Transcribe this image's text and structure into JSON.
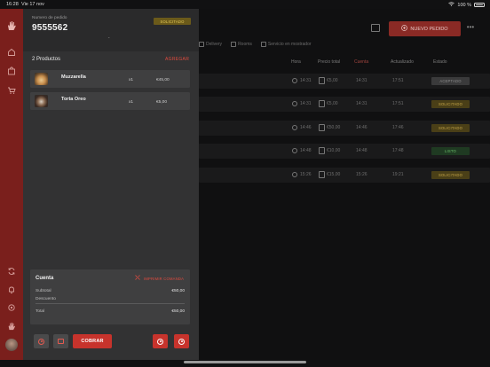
{
  "status_bar": {
    "time": "16:28",
    "date": "Vie 17 nov",
    "battery": "100 %"
  },
  "background": {
    "new_order_label": "NUEVO PEDIDO",
    "tabs": [
      "Delivery",
      "Rooms",
      "Servicio en mostrador"
    ],
    "columns": [
      "Hora",
      "Precio total",
      "Cuenta",
      "Actualizado",
      "Estado"
    ],
    "rows": [
      {
        "time": "14:31",
        "total": "€5,00",
        "cuenta": "14:31",
        "updated": "17:51",
        "status": "ACEPTADO",
        "status_color": "#8e8e8e",
        "status_bg": "#3a3a3b"
      },
      {
        "time": "14:31",
        "total": "€5,00",
        "cuenta": "14:31",
        "updated": "17:51",
        "status": "SOLICITADO",
        "status_color": "#c9a94a",
        "status_bg": "#4a3f17"
      },
      {
        "time": "14:46",
        "total": "€50,00",
        "cuenta": "14:46",
        "updated": "17:46",
        "status": "SOLICITADO",
        "status_color": "#c9a94a",
        "status_bg": "#4a3f17"
      },
      {
        "time": "14:48",
        "total": "€10,00",
        "cuenta": "14:48",
        "updated": "17:48",
        "status": "LISTO",
        "status_color": "#6bbf6b",
        "status_bg": "#1f3a22"
      },
      {
        "time": "15:26",
        "total": "€15,00",
        "cuenta": "15:26",
        "updated": "19:21",
        "status": "SOLICITADO",
        "status_color": "#c9a94a",
        "status_bg": "#4a3f17"
      }
    ]
  },
  "order": {
    "number_label": "Numero de pedido",
    "number": "9555562",
    "status": "SOLICITADO",
    "products_title": "2 Productos",
    "add_label": "AGREGAR",
    "products": [
      {
        "name": "Muzzarella",
        "qty": "x1",
        "price": "€45,00"
      },
      {
        "name": "Torta Oreo",
        "qty": "x1",
        "price": "€5,00"
      }
    ],
    "account": {
      "title": "Cuenta",
      "print_label": "IMPRIMIR COMANDA",
      "subtotal_label": "Subtotal",
      "subtotal": "€50,00",
      "discount_label": "Descuento",
      "discount": "",
      "total_label": "Total",
      "total": "€50,00"
    },
    "charge_label": "COBRAR"
  },
  "colors": {
    "accent": "#c7332c",
    "rail": "#7a1f1c",
    "drawer": "#323233",
    "solicitado": "#e3c95a"
  },
  "icons": {
    "rail": [
      "hand-logo-icon",
      "home-icon",
      "bag-icon",
      "cart-icon",
      "sync-icon",
      "bell-icon",
      "settings-icon",
      "hand-icon",
      "avatar"
    ]
  }
}
